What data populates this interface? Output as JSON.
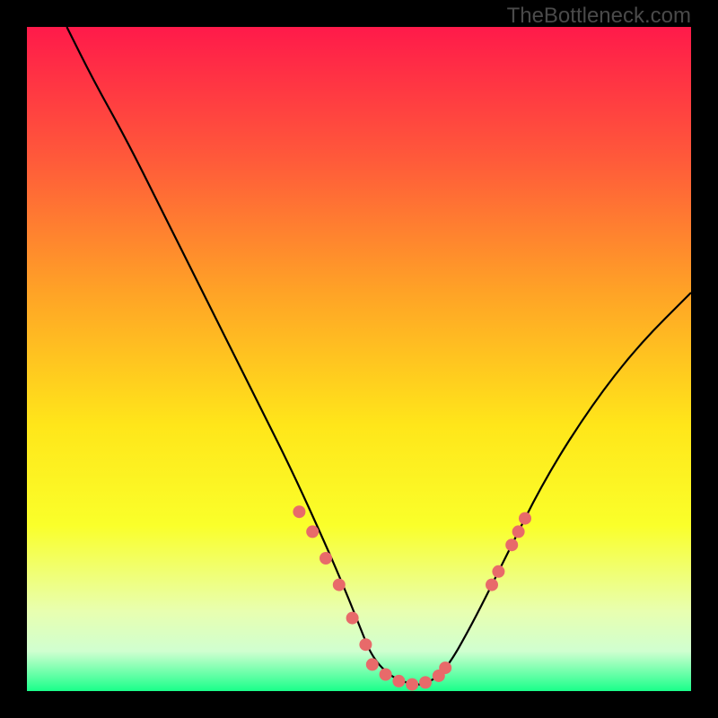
{
  "watermark": "TheBottleneck.com",
  "chart_data": {
    "type": "line",
    "title": "",
    "xlabel": "",
    "ylabel": "",
    "xlim": [
      0,
      100
    ],
    "ylim": [
      0,
      100
    ],
    "gradient_stops": [
      {
        "offset": 0,
        "color": "#ff1a4a"
      },
      {
        "offset": 20,
        "color": "#ff5a3a"
      },
      {
        "offset": 40,
        "color": "#ffa326"
      },
      {
        "offset": 60,
        "color": "#ffe61a"
      },
      {
        "offset": 75,
        "color": "#faff2a"
      },
      {
        "offset": 88,
        "color": "#e8ffb0"
      },
      {
        "offset": 94,
        "color": "#d0ffd0"
      },
      {
        "offset": 100,
        "color": "#1aff8a"
      }
    ],
    "series": [
      {
        "name": "bottleneck-curve",
        "color": "#000000",
        "x": [
          6,
          10,
          15,
          20,
          25,
          30,
          35,
          40,
          45,
          48,
          50,
          52,
          55,
          58,
          60,
          63,
          67,
          72,
          78,
          85,
          92,
          100
        ],
        "values": [
          100,
          92,
          83,
          73,
          63,
          53,
          43,
          33,
          22,
          15,
          10,
          5,
          2,
          1,
          1,
          3,
          10,
          20,
          32,
          43,
          52,
          60
        ]
      }
    ],
    "markers": {
      "name": "highlight-points",
      "color": "#e86a6a",
      "radius": 7,
      "points": [
        {
          "x": 41,
          "y": 27
        },
        {
          "x": 43,
          "y": 24
        },
        {
          "x": 45,
          "y": 20
        },
        {
          "x": 47,
          "y": 16
        },
        {
          "x": 49,
          "y": 11
        },
        {
          "x": 51,
          "y": 7
        },
        {
          "x": 52,
          "y": 4
        },
        {
          "x": 54,
          "y": 2.5
        },
        {
          "x": 56,
          "y": 1.5
        },
        {
          "x": 58,
          "y": 1
        },
        {
          "x": 60,
          "y": 1.3
        },
        {
          "x": 62,
          "y": 2.3
        },
        {
          "x": 63,
          "y": 3.5
        },
        {
          "x": 70,
          "y": 16
        },
        {
          "x": 71,
          "y": 18
        },
        {
          "x": 73,
          "y": 22
        },
        {
          "x": 74,
          "y": 24
        },
        {
          "x": 75,
          "y": 26
        }
      ]
    }
  }
}
